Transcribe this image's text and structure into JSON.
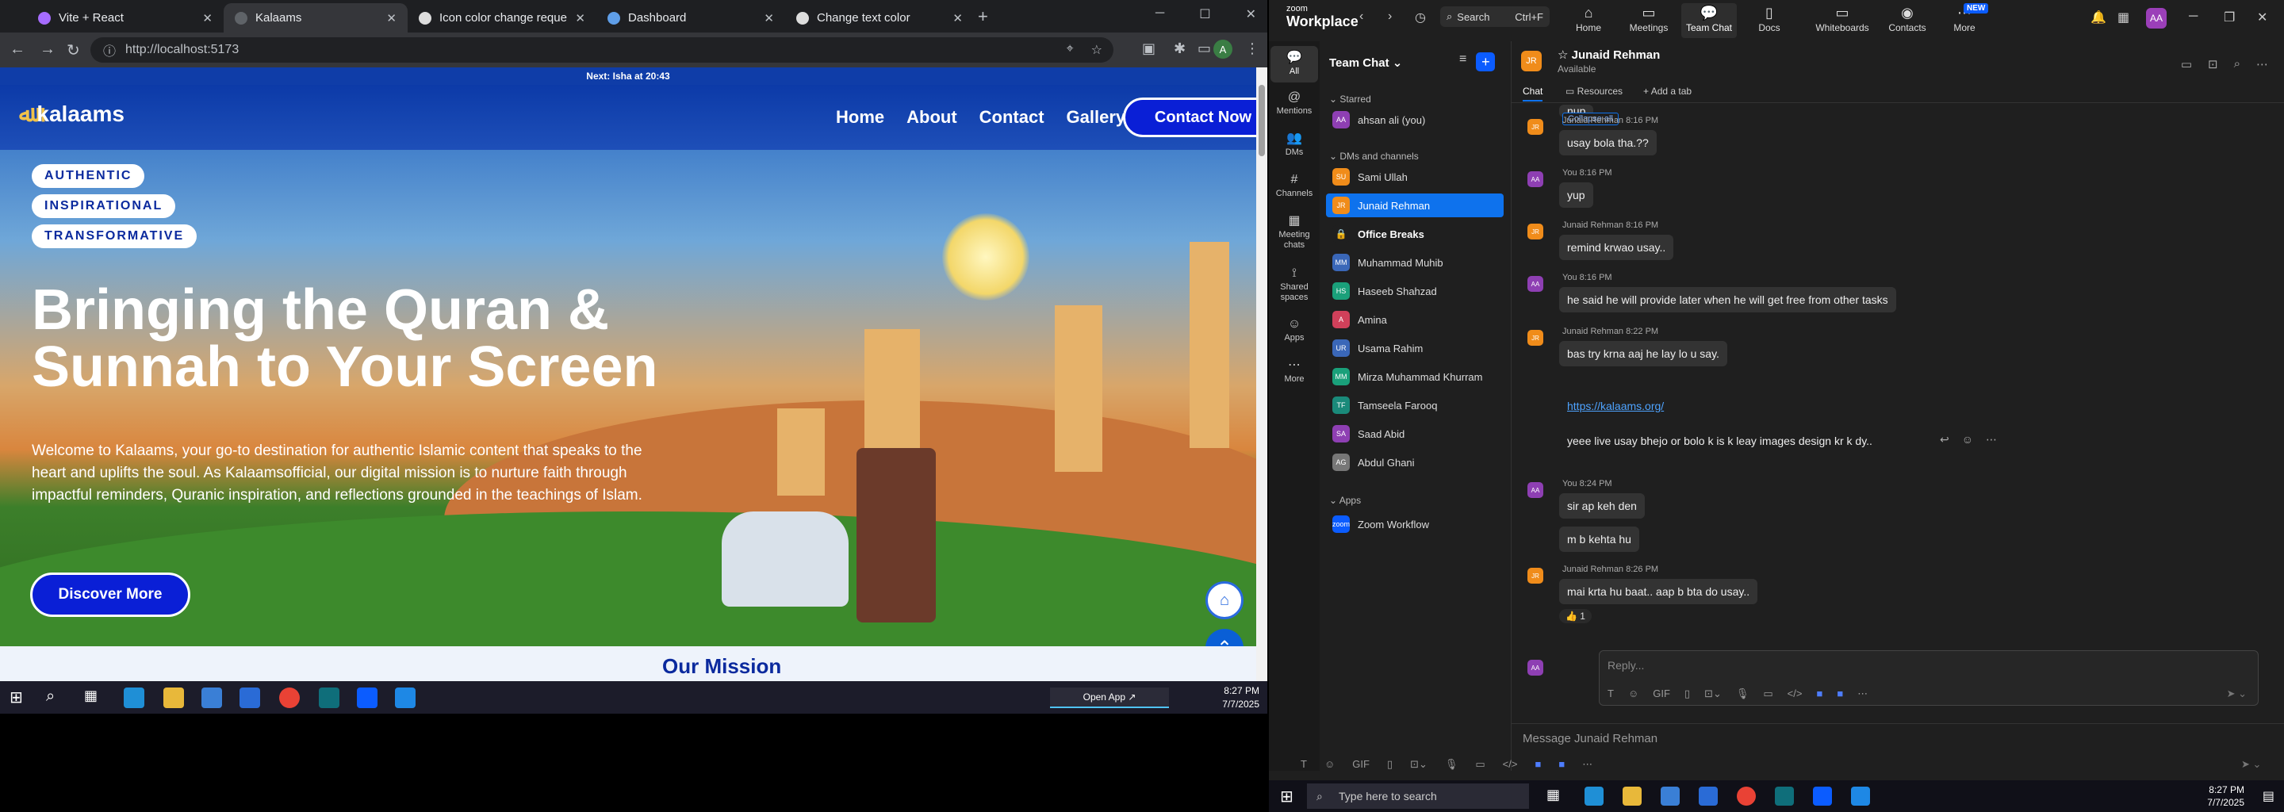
{
  "browser": {
    "tabs": [
      {
        "title": "Vite + React"
      },
      {
        "title": "Kalaams"
      },
      {
        "title": "Icon color change request"
      },
      {
        "title": "Dashboard"
      },
      {
        "title": "Change text color"
      }
    ],
    "url": "http://localhost:5173",
    "profile_initial": "A"
  },
  "site": {
    "topbar": "Next: Isha at 20:43",
    "logo": "kalaams",
    "nav": [
      "Home",
      "About",
      "Contact",
      "Gallery"
    ],
    "cta": "Contact Now",
    "pills": [
      "AUTHENTIC",
      "INSPIRATIONAL",
      "TRANSFORMATIVE"
    ],
    "headline": "Bringing the Quran & Sunnah to Your Screen",
    "intro": "Welcome to Kalaams, your go-to destination for authentic Islamic content that speaks to the heart and uplifts the soul. As Kalaamsofficial, our digital mission is to nurture faith through impactful reminders, Quranic inspiration, and reflections grounded in the teachings of Islam.",
    "discover": "Discover More",
    "next_section": "Our Mission"
  },
  "taskbar_left": {
    "time": "8:27 PM",
    "date": "7/7/2025",
    "open_app": "Open App ↗"
  },
  "zoom": {
    "brand_top": "zoom",
    "brand": "Workplace",
    "search": "Search",
    "search_shortcut": "Ctrl+F",
    "tabs": [
      "Home",
      "Meetings",
      "Team Chat",
      "Docs",
      "Whiteboards",
      "Contacts",
      "More"
    ],
    "new_badge": "NEW",
    "me_initials": "AA",
    "rail": [
      "All",
      "Mentions",
      "DMs",
      "Channels",
      "Meeting chats",
      "Shared spaces",
      "Apps",
      "More"
    ],
    "sidebar_title": "Team Chat",
    "sections": {
      "starred": "Starred",
      "dms": "DMs and channels",
      "apps": "Apps"
    },
    "starred": [
      {
        "name": "ahsan ali (you)",
        "initials": "AA",
        "color": "#8e3fb3"
      }
    ],
    "contacts": [
      {
        "name": "Sami Ullah",
        "initials": "SU",
        "color": "#f08c1a"
      },
      {
        "name": "Junaid Rehman",
        "initials": "JR",
        "color": "#f08c1a"
      },
      {
        "name": "Office Breaks",
        "initials": "",
        "color": "#1f1f1f"
      },
      {
        "name": "Muhammad Muhib",
        "initials": "MM",
        "color": "#3a67b8"
      },
      {
        "name": "Haseeb Shahzad",
        "initials": "HS",
        "color": "#1aa07a"
      },
      {
        "name": "Amina",
        "initials": "A",
        "color": "#d0405a"
      },
      {
        "name": "Usama Rahim",
        "initials": "UR",
        "color": "#3a67b8"
      },
      {
        "name": "Mirza Muhammad Khurram",
        "initials": "MM",
        "color": "#1aa07a"
      },
      {
        "name": "Tamseela Farooq",
        "initials": "TF",
        "color": "#1a8a7a"
      },
      {
        "name": "Saad Abid",
        "initials": "SA",
        "color": "#8e3fb3"
      },
      {
        "name": "Abdul Ghani",
        "initials": "AG",
        "color": "#777777"
      }
    ],
    "apps": [
      {
        "name": "Zoom Workflow",
        "initials": "zoom",
        "color": "#0b5cff"
      }
    ],
    "chat": {
      "name": "Junaid Rehman",
      "status": "Available",
      "initials": "JR",
      "tabs": [
        "Chat",
        "Resources",
        "Add a tab"
      ],
      "collapse": "Collapse all",
      "top_partial": "nup",
      "messages": [
        {
          "meta": "Junaid Rehman 8:16 PM",
          "text": "usay bola tha.??",
          "from": "JR"
        },
        {
          "meta": "You 8:16 PM",
          "text": "yup",
          "from": "AA"
        },
        {
          "meta": "Junaid Rehman 8:16 PM",
          "text": "remind krwao usay..",
          "from": "JR"
        },
        {
          "meta": "You 8:16 PM",
          "text": "he said he will provide later when he will get free from other tasks",
          "from": "AA"
        },
        {
          "meta": "Junaid Rehman 8:22 PM",
          "text": "bas try krna aaj he lay lo u say.",
          "from": "JR"
        },
        {
          "meta": "",
          "text": "https://kalaams.org/",
          "from": ""
        },
        {
          "meta": "",
          "text": "yeee live usay bhejo or bolo k is k leay images design kr k dy..",
          "from": ""
        },
        {
          "meta": "You 8:24 PM",
          "text": "sir ap keh den",
          "from": "AA"
        },
        {
          "meta": "",
          "text": "m b kehta hu",
          "from": ""
        },
        {
          "meta": "Junaid Rehman 8:26 PM",
          "text": "mai krta hu baat.. aap b bta do usay..",
          "from": "JR"
        }
      ],
      "reaction": "👍 1",
      "reply_placeholder": "Reply...",
      "composer_placeholder": "Message Junaid Rehman"
    }
  },
  "taskbar_right": {
    "search": "Type here to search",
    "time": "8:27 PM",
    "date": "7/7/2025"
  }
}
